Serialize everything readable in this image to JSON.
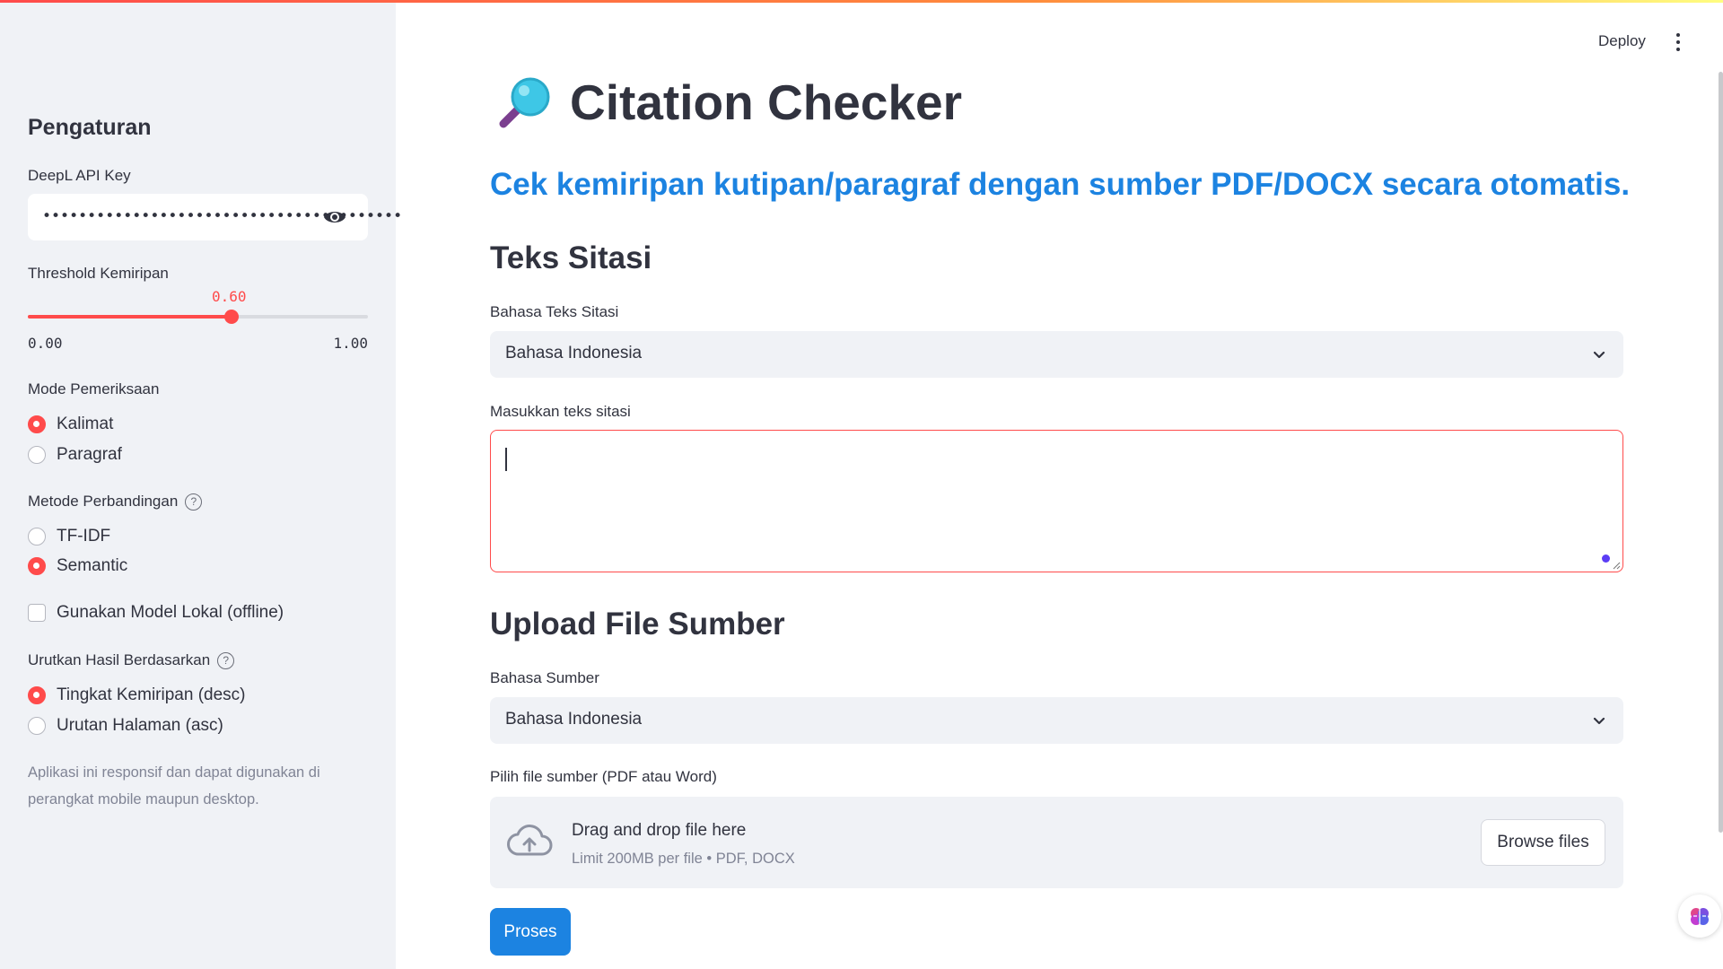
{
  "sidebar": {
    "title": "Pengaturan",
    "api_key": {
      "label": "DeepL API Key",
      "masked_value": "••••••••••••••••••••••••••••••••••••••••"
    },
    "threshold": {
      "label": "Threshold Kemiripan",
      "value": "0.60",
      "value_fraction": 0.6,
      "min": "0.00",
      "max": "1.00"
    },
    "mode": {
      "label": "Mode Pemeriksaan",
      "options": [
        "Kalimat",
        "Paragraf"
      ],
      "selected": "Kalimat"
    },
    "method": {
      "label": "Metode Perbandingan",
      "options": [
        "TF-IDF",
        "Semantic"
      ],
      "selected": "Semantic"
    },
    "local_model": {
      "label": "Gunakan Model Lokal (offline)",
      "checked": false
    },
    "sort": {
      "label": "Urutkan Hasil Berdasarkan",
      "options": [
        "Tingkat Kemiripan (desc)",
        "Urutan Halaman (asc)"
      ],
      "selected": "Tingkat Kemiripan (desc)"
    },
    "footer": "Aplikasi ini responsif dan dapat digunakan di perangkat mobile maupun desktop."
  },
  "header": {
    "deploy_label": "Deploy"
  },
  "main": {
    "title": "Citation Checker",
    "subtitle": "Cek kemiripan kutipan/paragraf dengan sumber PDF/DOCX secara otomatis.",
    "citation_section": {
      "heading": "Teks Sitasi",
      "language_label": "Bahasa Teks Sitasi",
      "language_value": "Bahasa Indonesia",
      "input_label": "Masukkan teks sitasi",
      "input_value": ""
    },
    "upload_section": {
      "heading": "Upload File Sumber",
      "language_label": "Bahasa Sumber",
      "language_value": "Bahasa Indonesia",
      "file_label": "Pilih file sumber (PDF atau Word)",
      "drop_text": "Drag and drop file here",
      "drop_hint": "Limit 200MB per file • PDF, DOCX",
      "browse_label": "Browse files"
    },
    "submit_label": "Proses"
  },
  "colors": {
    "accent": "#ff4b4b",
    "primary": "#1c83e1",
    "sidebar_bg": "#f0f2f6",
    "text": "#31333f"
  }
}
